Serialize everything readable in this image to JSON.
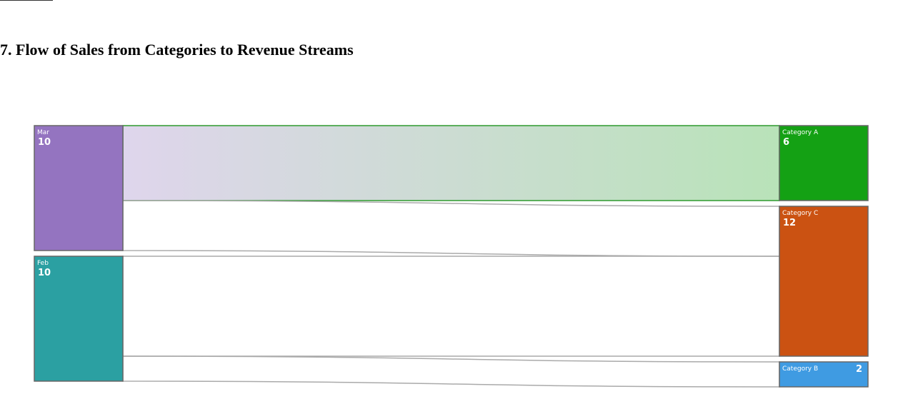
{
  "chart_data": {
    "type": "sankey",
    "title": "7. Flow of Sales from Categories to Revenue Streams",
    "nodes": [
      {
        "id": "Mar",
        "name": "Mar",
        "value": 10,
        "color": "#9474c0",
        "column": 0
      },
      {
        "id": "Feb",
        "name": "Feb",
        "value": 10,
        "color": "#2ba0a2",
        "column": 0
      },
      {
        "id": "Category A",
        "name": "Category A",
        "value": 6,
        "color": "#14a114",
        "column": 1
      },
      {
        "id": "Category C",
        "name": "Category C",
        "value": 12,
        "color": "#cb5212",
        "column": 1
      },
      {
        "id": "Category B",
        "name": "Category B",
        "value": 2,
        "color": "#3f9be2",
        "column": 1
      }
    ],
    "links": [
      {
        "source": "Mar",
        "target": "Category A",
        "value": 6,
        "highlighted": true
      },
      {
        "source": "Mar",
        "target": "Category C",
        "value": 4
      },
      {
        "source": "Feb",
        "target": "Category C",
        "value": 8
      },
      {
        "source": "Feb",
        "target": "Category B",
        "value": 2
      }
    ],
    "colors": {
      "node_border": "#666666",
      "link_stroke": "#aaaaaa",
      "highlight_stroke": "#2e9a2e"
    }
  }
}
